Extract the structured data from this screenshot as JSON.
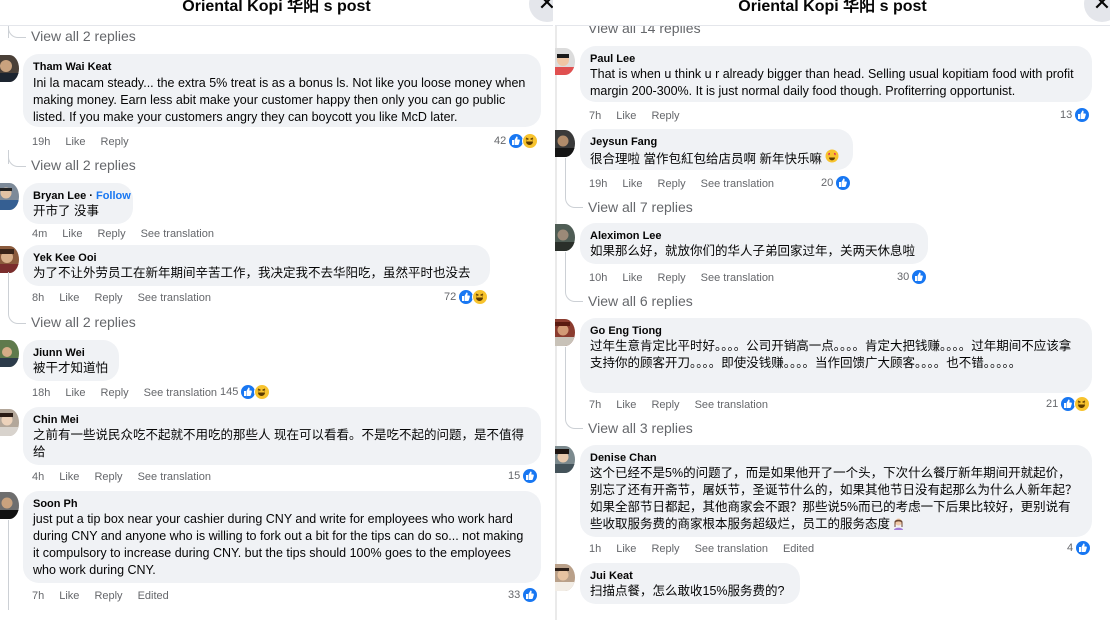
{
  "left": {
    "title": "Oriental Kopi 华阳 s post",
    "close": "✕",
    "view_replies_top": "View all 2 replies",
    "comments": [
      {
        "author": "Tham Wai Keat",
        "text": "Ini la macam steady... the extra 5% treat is as a bonus ls. Not like you loose money when making money. Earn less abit make your customer happy then only you can go public listed. If you make your customers angry they can boycott you like McD later.",
        "time": "19h",
        "like": "Like",
        "reply": "Reply",
        "count": "42",
        "replies": "View all 2 replies"
      },
      {
        "author": "Bryan Lee",
        "follow": "Follow",
        "sep": " · ",
        "text": "开市了 没事",
        "time": "4m",
        "like": "Like",
        "reply": "Reply",
        "translate": "See translation"
      },
      {
        "author": "Yek Kee Ooi",
        "text": "为了不让外劳员工在新年期间辛苦工作，我决定我不去华阳吃，虽然平时也没去",
        "time": "8h",
        "like": "Like",
        "reply": "Reply",
        "translate": "See translation",
        "count": "72",
        "replies": "View all 2 replies"
      },
      {
        "author": "Jiunn Wei",
        "text": "被干才知道怕",
        "time": "18h",
        "like": "Like",
        "reply": "Reply",
        "translate": "See translation",
        "count": "145"
      },
      {
        "author": "Chin Mei",
        "text": "之前有一些说民众吃不起就不用吃的那些人 现在可以看看。不是吃不起的问题，是不值得给",
        "time": "4h",
        "like": "Like",
        "reply": "Reply",
        "translate": "See translation",
        "count": "15"
      },
      {
        "author": "Soon Ph",
        "text": "just put a tip box near your cashier during CNY and write for employees who work hard during CNY and anyone who is willing to fork out a bit for the tips can do so... not making it compulsory to increase during CNY. but the tips should 100% goes to the employees who work during CNY.",
        "time": "7h",
        "like": "Like",
        "reply": "Reply",
        "edited": "Edited",
        "count": "33"
      }
    ]
  },
  "right": {
    "title": "Oriental Kopi 华阳 s post",
    "close": "✕",
    "view_replies_top": "View all 14 replies",
    "comments": [
      {
        "author": "Paul Lee",
        "text": "That is when u think u r already bigger than head. Selling usual kopitiam food with profit margin 200-300%. It is just normal daily food though. Profiterring opportunist.",
        "time": "7h",
        "like": "Like",
        "reply": "Reply",
        "count": "13"
      },
      {
        "author": "Jeysun Fang",
        "text": "很合理啦 當作包紅包给店员啊 新年快乐嘛",
        "time": "19h",
        "like": "Like",
        "reply": "Reply",
        "translate": "See translation",
        "count": "20",
        "replies": "View all 7 replies"
      },
      {
        "author": "Aleximon Lee",
        "text": "如果那么好，就放你们的华人子弟回家过年，关两天休息啦",
        "time": "10h",
        "like": "Like",
        "reply": "Reply",
        "translate": "See translation",
        "count": "30",
        "replies": "View all 6 replies"
      },
      {
        "author": "Go Eng Tiong",
        "text": "过年生意肯定比平时好。。。。公司开销高一点。。。。肯定大把钱赚。。。。过年期间不应该拿支持你的顾客开刀。。。。即使没钱赚。。。。当作回馈广大顾客。。。。也不错。。。。。",
        "time": "7h",
        "like": "Like",
        "reply": "Reply",
        "translate": "See translation",
        "count": "21",
        "replies": "View all 3 replies"
      },
      {
        "author": "Denise Chan",
        "text": "这个已经不是5%的问题了，而是如果他开了一个头，下次什么餐厅新年期间开就起价，别忘了还有开斋节，屠妖节，圣诞节什么的，如果其他节日没有起那么为什么人新年起？如果全部节日都起，其他商家会不跟？那些说5%而已的考虑一下后果比较好，更别说有些收取服务费的商家根本服务超级烂，员工的服务态度",
        "time": "1h",
        "like": "Like",
        "reply": "Reply",
        "translate": "See translation",
        "edited": "Edited",
        "count": "4"
      },
      {
        "author": "Jui Keat",
        "text": "扫描点餐，怎么敢收15%服务费的?"
      }
    ]
  },
  "colors": {
    "like": "#1877f2",
    "haha": "#f7c32e",
    "bubble": "#f0f2f5",
    "meta": "#65676b"
  }
}
